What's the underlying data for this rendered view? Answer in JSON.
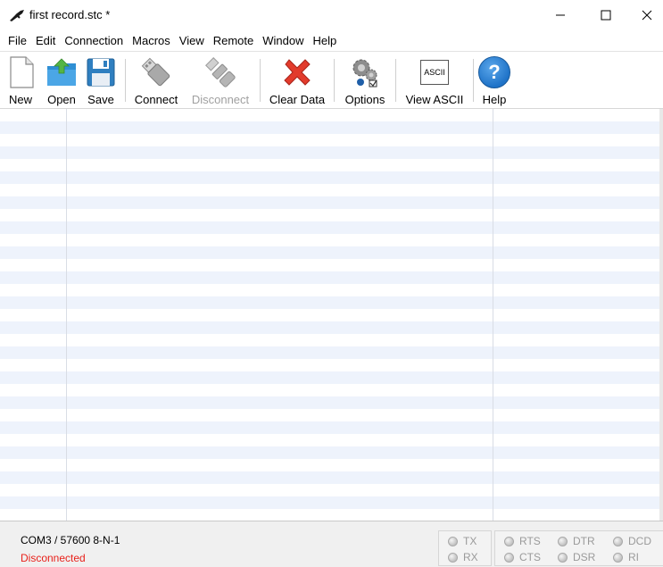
{
  "window": {
    "title": "first record.stc *",
    "controls": {
      "minimize": "—",
      "maximize": "☐",
      "close": "✕"
    }
  },
  "menu": [
    "File",
    "Edit",
    "Connection",
    "Macros",
    "View",
    "Remote",
    "Window",
    "Help"
  ],
  "toolbar": {
    "new": "New",
    "open": "Open",
    "save": "Save",
    "connect": "Connect",
    "disconnect": "Disconnect",
    "clear_data": "Clear Data",
    "options": "Options",
    "view_ascii": "View ASCII",
    "ascii_icon_text": "ASCII",
    "help": "Help",
    "help_icon_text": "?"
  },
  "status": {
    "port_settings": "COM3 / 57600 8-N-1",
    "connection": "Disconnected",
    "connection_color": "#e8211b",
    "leds": {
      "tx": "TX",
      "rx": "RX",
      "rts": "RTS",
      "cts": "CTS",
      "dtr": "DTR",
      "dsr": "DSR",
      "dcd": "DCD",
      "ri": "RI"
    }
  },
  "colors": {
    "row_stripe": "#eef3fc",
    "help_blue": "#1f73c8",
    "clear_red": "#e23b2c",
    "open_green": "#54b544"
  }
}
